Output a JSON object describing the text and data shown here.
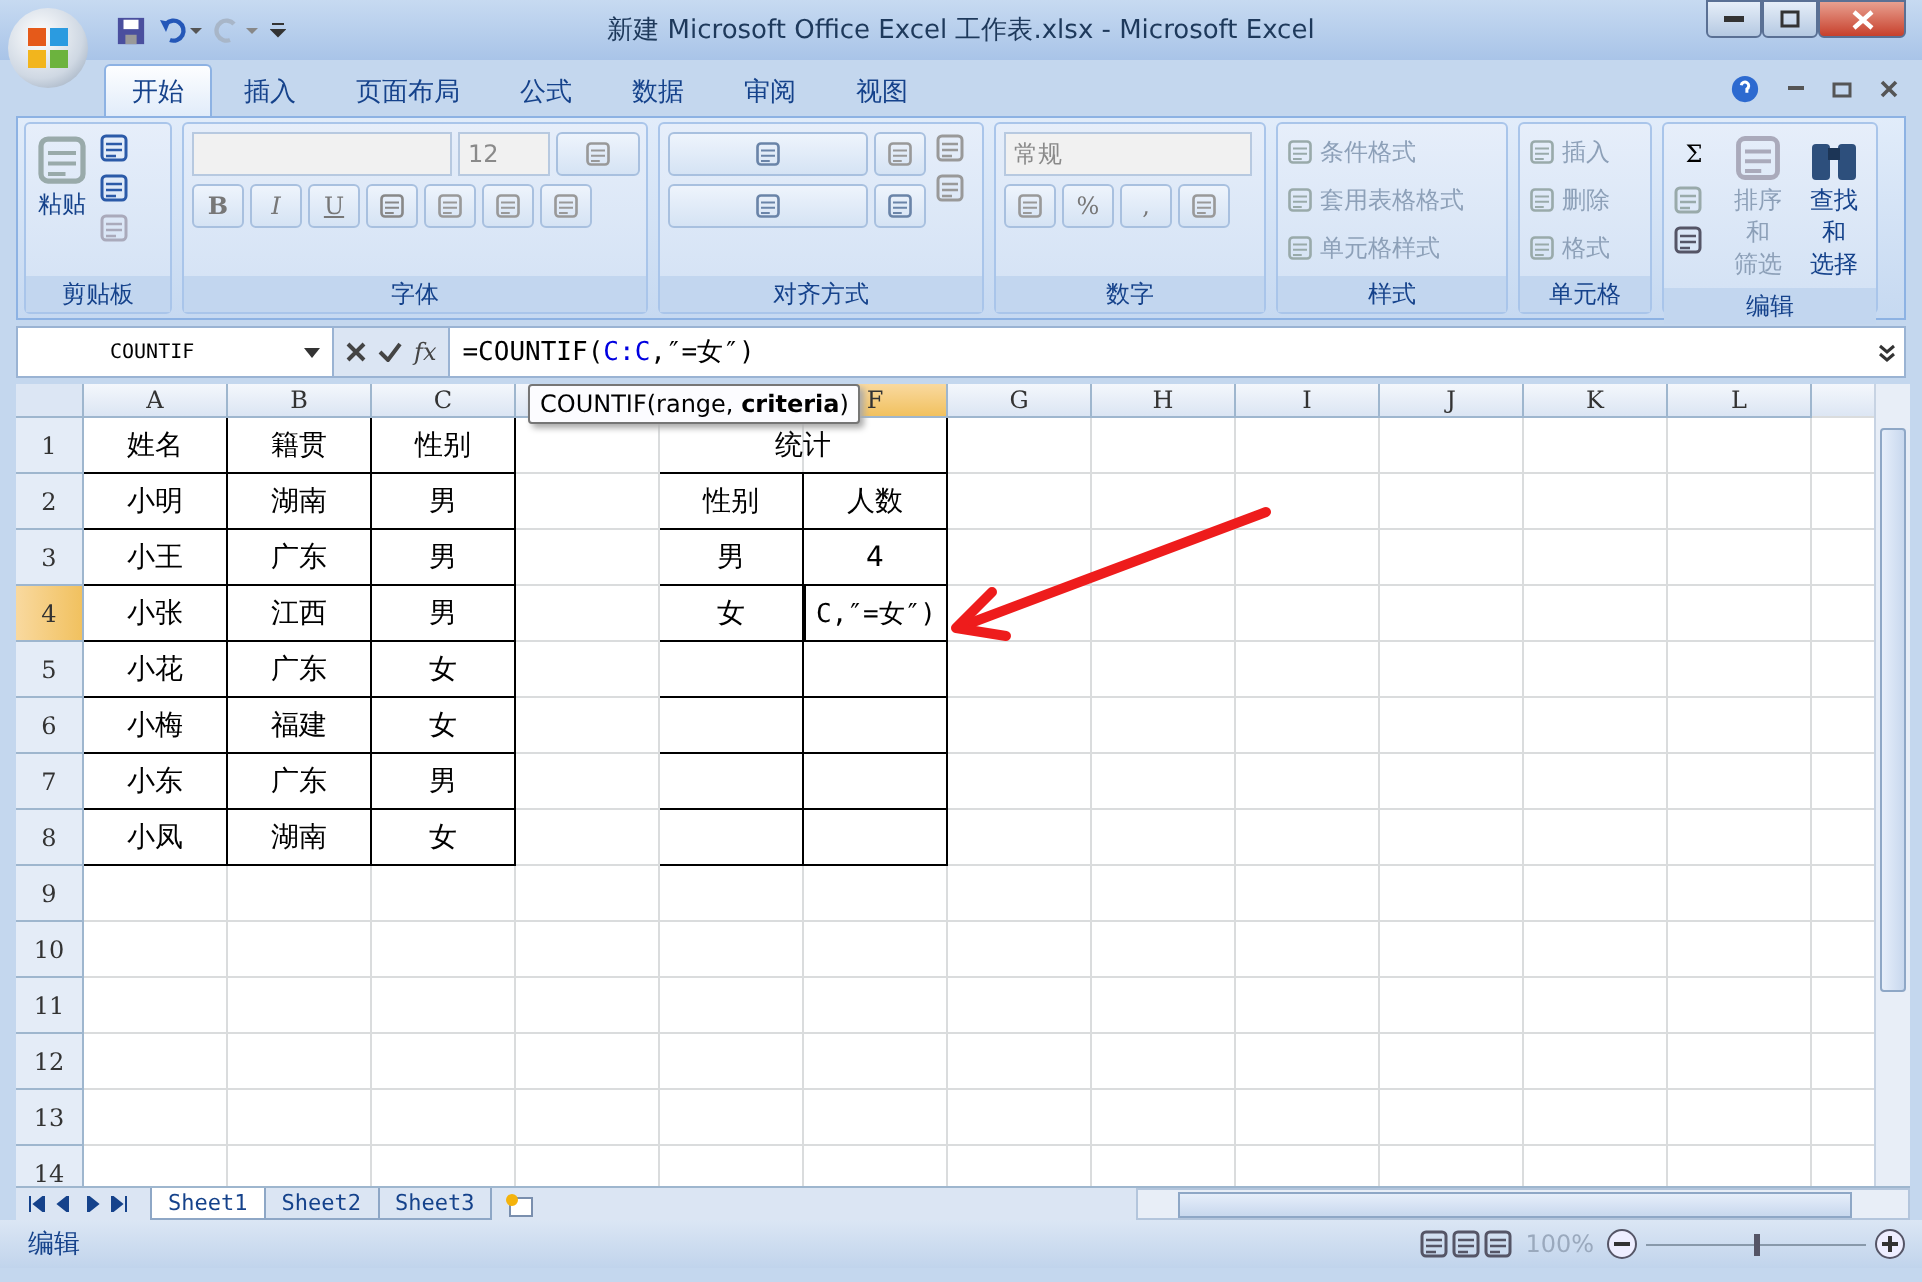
{
  "window": {
    "title": "新建 Microsoft Office Excel 工作表.xlsx - Microsoft Excel"
  },
  "ribbon_tabs": [
    {
      "label": "开始",
      "selected": true
    },
    {
      "label": "插入",
      "selected": false
    },
    {
      "label": "页面布局",
      "selected": false
    },
    {
      "label": "公式",
      "selected": false
    },
    {
      "label": "数据",
      "selected": false
    },
    {
      "label": "审阅",
      "selected": false
    },
    {
      "label": "视图",
      "selected": false
    }
  ],
  "ribbon": {
    "paste": "粘贴",
    "clipboard": "剪贴板",
    "font_size": "12",
    "bold": "B",
    "italic": "I",
    "underline": "U",
    "font": "字体",
    "alignment": "对齐方式",
    "number_format": "常规",
    "percent": "%",
    "comma": ",",
    "number": "数字",
    "styles_items": [
      "条件格式",
      "套用表格格式",
      "单元格样式"
    ],
    "styles": "样式",
    "cells_items": [
      "插入",
      "删除",
      "格式"
    ],
    "cells": "单元格",
    "sum": "Σ",
    "sort": [
      "排序和",
      "筛选"
    ],
    "find": [
      "查找和",
      "选择"
    ],
    "editing": "编辑"
  },
  "formula_bar": {
    "name_box": "COUNTIF",
    "fx": "fx",
    "formula": [
      {
        "kind": "plain",
        "text": "=COUNTIF("
      },
      {
        "kind": "ref",
        "text": "C:C"
      },
      {
        "kind": "plain",
        "text": ",″=女″)"
      }
    ]
  },
  "tooltip": "COUNTIF(range, **criteria**)",
  "columns_left": [
    {
      "label": "A",
      "selected": false
    },
    {
      "label": "B",
      "selected": false
    },
    {
      "label": "C",
      "selected": false
    }
  ],
  "columns_right": [
    {
      "label": "F",
      "selected": true
    },
    {
      "label": "G",
      "selected": false
    },
    {
      "label": "H",
      "selected": false
    },
    {
      "label": "I",
      "selected": false
    },
    {
      "label": "J",
      "selected": false
    },
    {
      "label": "K",
      "selected": false
    },
    {
      "label": "L",
      "selected": false
    }
  ],
  "rows": [
    {
      "label": "1",
      "selected": false,
      "cells": {
        "A": "姓名",
        "B": "籍贯",
        "C": "性别",
        "E": {
          "text": "统计",
          "kind": "merged"
        }
      }
    },
    {
      "label": "2",
      "selected": false,
      "cells": {
        "A": "小明",
        "B": "湖南",
        "C": "男",
        "E": "性别",
        "F": "人数"
      }
    },
    {
      "label": "3",
      "selected": false,
      "cells": {
        "A": "小王",
        "B": "广东",
        "C": "男",
        "E": "男",
        "F": "4"
      }
    },
    {
      "label": "4",
      "selected": true,
      "cells": {
        "A": "小张",
        "B": "江西",
        "C": "男",
        "E": "女",
        "F": {
          "text": "C,″=女″)",
          "kind": "editing"
        }
      }
    },
    {
      "label": "5",
      "selected": false,
      "cells": {
        "A": "小花",
        "B": "广东",
        "C": "女"
      }
    },
    {
      "label": "6",
      "selected": false,
      "cells": {
        "A": "小梅",
        "B": "福建",
        "C": "女"
      }
    },
    {
      "label": "7",
      "selected": false,
      "cells": {
        "A": "小东",
        "B": "广东",
        "C": "男"
      }
    },
    {
      "label": "8",
      "selected": false,
      "cells": {
        "A": "小凤",
        "B": "湖南",
        "C": "女"
      }
    },
    {
      "label": "9",
      "selected": false,
      "cells": {}
    },
    {
      "label": "10",
      "selected": false,
      "cells": {}
    },
    {
      "label": "11",
      "selected": false,
      "cells": {}
    },
    {
      "label": "12",
      "selected": false,
      "cells": {}
    },
    {
      "label": "13",
      "selected": false,
      "cells": {}
    },
    {
      "label": "14",
      "selected": false,
      "cells": {}
    }
  ],
  "sheet_tabs": [
    {
      "label": "Sheet1",
      "selected": true
    },
    {
      "label": "Sheet2",
      "selected": false
    },
    {
      "label": "Sheet3",
      "selected": false
    }
  ],
  "status_bar": {
    "mode": "编辑",
    "zoom": "100%",
    "zoom_slider": {
      "level": 0.5
    }
  }
}
